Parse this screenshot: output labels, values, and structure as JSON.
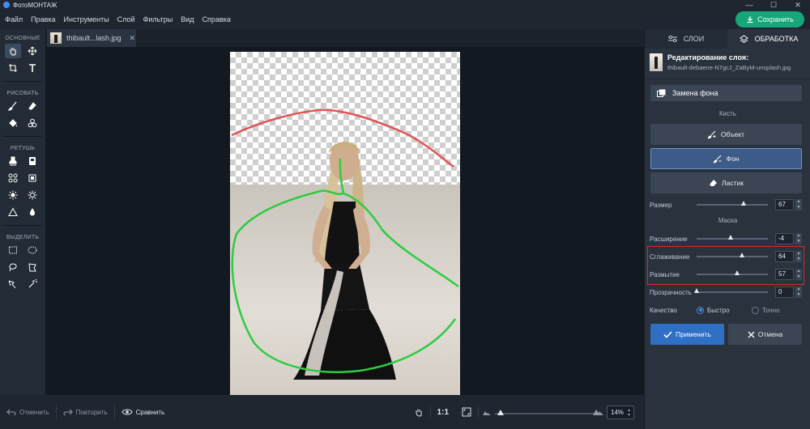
{
  "window": {
    "title": "ФотоМОНТАЖ",
    "controls": [
      "—",
      "☐",
      "✕"
    ]
  },
  "menu": [
    "Файл",
    "Правка",
    "Инструменты",
    "Слой",
    "Фильтры",
    "Вид",
    "Справка"
  ],
  "save_label": "Сохранить",
  "tool_groups": {
    "basic": "ОСНОВНЫЕ",
    "draw": "РИСОВАТЬ",
    "retouch": "РЕТУШЬ",
    "select": "ВЫДЕЛИТЬ"
  },
  "document_tab": {
    "name": "thibault...lash.jpg",
    "close": "✕"
  },
  "bottom": {
    "undo": "Отменить",
    "redo": "Повторить",
    "compare": "Сравнить",
    "ratio": "1:1",
    "zoom": "14%"
  },
  "panel": {
    "tabs": [
      "СЛОИ",
      "ОБРАБОТКА"
    ],
    "layer_title": "Редактирование слоя:",
    "layer_file": "thibault-debaene-N7gcJ_ZaByM-unsplash.jpg",
    "bg_replace": "Замена фона",
    "brush_header": "Кисть",
    "brushes": {
      "object": "Объект",
      "background": "Фон",
      "eraser": "Ластик"
    },
    "mask_header": "Маска",
    "sliders": {
      "size": {
        "label": "Размер",
        "value": "67",
        "level": 0.67
      },
      "expand": {
        "label": "Расширение",
        "value": "-4",
        "level": 0.48
      },
      "smooth": {
        "label": "Сглаживание",
        "value": "64",
        "level": 0.64
      },
      "blur": {
        "label": "Размытие",
        "value": "57",
        "level": 0.57
      },
      "opacity": {
        "label": "Прозрачность",
        "value": "0",
        "level": 0.0
      }
    },
    "quality": {
      "label": "Качество",
      "fast": "Быстро",
      "precise": "Точно"
    },
    "apply": "Применить",
    "cancel": "Отмена"
  },
  "colors": {
    "accent": "#16a67a",
    "primary": "#2f6fc4",
    "object_stroke": "#2ecc40",
    "background_stroke": "#e05555",
    "highlight": "#e0262a"
  }
}
